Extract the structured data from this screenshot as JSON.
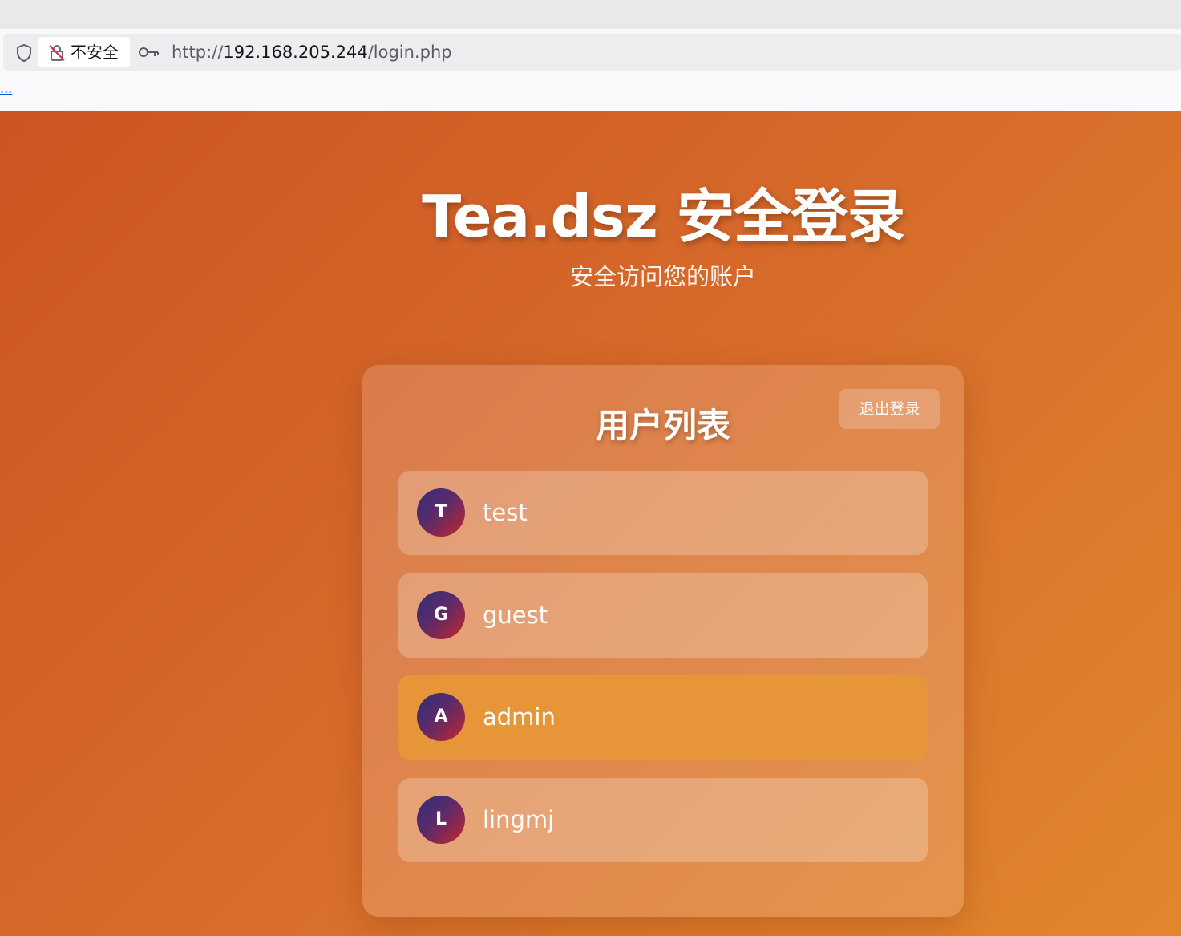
{
  "browser": {
    "security_label": "不安全",
    "url_scheme": "http://",
    "url_host": "192.168.205.244",
    "url_path": "/login.php",
    "bookmark_overflow": "..."
  },
  "page": {
    "title": "Tea.dsz 安全登录",
    "subtitle": "安全访问您的账户"
  },
  "card": {
    "title": "用户列表",
    "logout_label": "退出登录",
    "users": [
      {
        "initial": "T",
        "name": "test",
        "highlighted": false
      },
      {
        "initial": "G",
        "name": "guest",
        "highlighted": false
      },
      {
        "initial": "A",
        "name": "admin",
        "highlighted": true
      },
      {
        "initial": "L",
        "name": "lingmj",
        "highlighted": false
      }
    ]
  },
  "colors": {
    "background_start": "#cc5523",
    "background_end": "#e2862c",
    "highlight_row": "#e79539",
    "avatar_start": "#2f2f7a",
    "avatar_end": "#c3262c"
  }
}
